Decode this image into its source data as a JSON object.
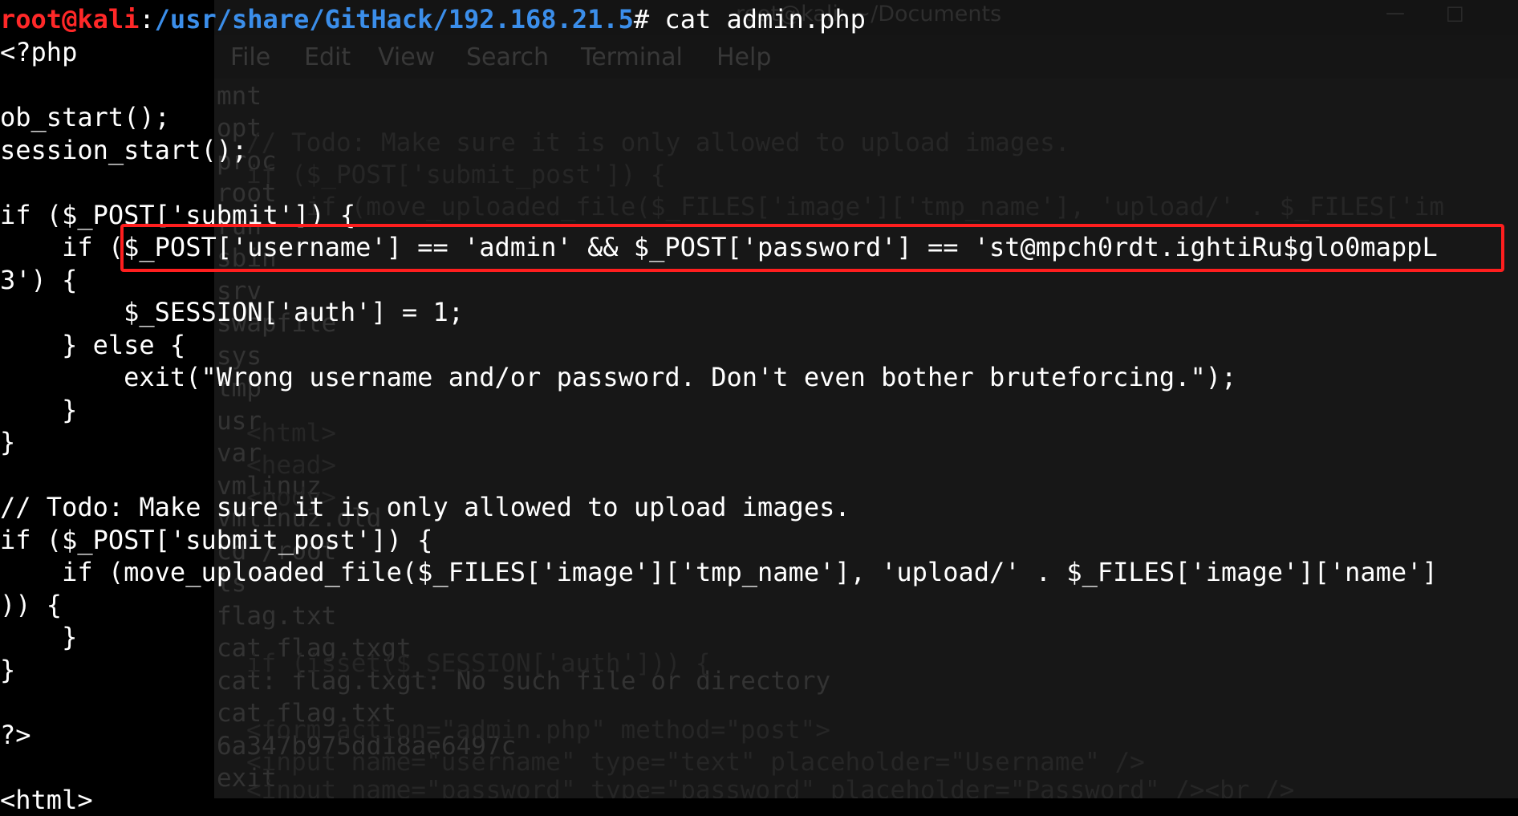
{
  "background_window": {
    "title": "root@kali: ~/Documents",
    "minimize": "—",
    "maximize": "□",
    "menu": [
      "File",
      "Edit",
      "View",
      "Search",
      "Terminal",
      "Help"
    ],
    "listing": [
      "mnt",
      "opt",
      "proc",
      "root",
      "run",
      "sbin",
      "srv",
      "swapfile",
      "sys",
      "tmp",
      "usr",
      "var",
      "vmlinuz",
      "vmlinuz.old",
      "cd /root",
      "ls",
      "flag.txt",
      "cat flag.txgt",
      "cat: flag.txgt: No such file or directory",
      "cat flag.txt",
      "6a347b975dd18ae6497c",
      "exit"
    ],
    "code_fragments": [
      "// Todo: Make sure it is only allowed to upload images.",
      "if ($_POST['submit_post']) {",
      "    if (move_uploaded_file($_FILES['image']['tmp_name'], 'upload/' . $_FILES['im",
      "<html>",
      "<head>",
      "<body>",
      "if (isset($_SESSION['auth'])) {",
      "<form action=\"admin.php\" method=\"post\">",
      "<input name=\"username\" type=\"text\" placeholder=\"Username\" />",
      "<input name=\"password\" type=\"password\" placeholder=\"Password\" /><br />"
    ]
  },
  "terminal": {
    "prompt_user": "root@kali",
    "prompt_sep": ":",
    "prompt_path": "/usr/share/GitHack/192.168.21.5",
    "prompt_symbol": "# ",
    "command": "cat admin.php",
    "lines": [
      "<?php",
      "",
      "ob_start();",
      "session_start();",
      "",
      "if ($_POST['submit']) {",
      "    if ($_POST['username'] == 'admin' && $_POST['password'] == 'st@mpch0rdt.ightiRu$glo0mappL",
      "3') {",
      "        $_SESSION['auth'] = 1;",
      "    } else {",
      "        exit(\"Wrong username and/or password. Don't even bother bruteforcing.\");",
      "    }",
      "}",
      "",
      "// Todo: Make sure it is only allowed to upload images.",
      "if ($_POST['submit_post']) {",
      "    if (move_uploaded_file($_FILES['image']['tmp_name'], 'upload/' . $_FILES['image']['name']",
      ")) {",
      "    }",
      "}",
      "",
      "?>",
      "",
      "<html>"
    ]
  },
  "colors": {
    "prompt_user": "#ff2828",
    "prompt_path": "#3b8eea",
    "highlight": "#ff1e1e",
    "text": "#ffffff",
    "background": "#000000"
  }
}
